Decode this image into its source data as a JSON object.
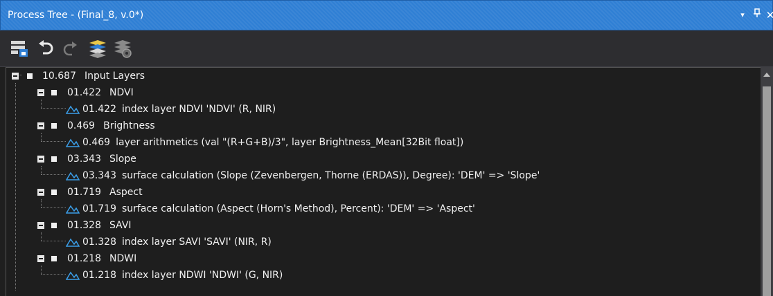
{
  "window": {
    "title": "Process Tree - (Final_8, v.0*)",
    "dropdown_glyph": "▾",
    "pin_glyph": "``",
    "close_glyph": "✕"
  },
  "toolbar": {
    "icons": [
      "rule-set-icon",
      "undo-icon",
      "redo-icon",
      "layers-icon",
      "layers-settings-icon"
    ],
    "colors": {
      "undo": "#e8e8e8",
      "redo_disabled": "#7a7a7a",
      "accent": "#2f7fd4",
      "accent_yellow": "#e8c84a"
    }
  },
  "tree": {
    "root": {
      "time": "10.687",
      "name": "Input Layers"
    },
    "groups": [
      {
        "time": "01.422",
        "name": "NDVI",
        "child": {
          "time": "01.422",
          "algorithm": "index layer NDVI 'NDVI' (R, NIR)"
        }
      },
      {
        "time": "0.469",
        "name": "Brightness",
        "child": {
          "time": "0.469",
          "algorithm": "layer arithmetics (val \"(R+G+B)/3\", layer Brightness_Mean[32Bit float])"
        }
      },
      {
        "time": "03.343",
        "name": "Slope",
        "child": {
          "time": "03.343",
          "algorithm": "surface calculation (Slope (Zevenbergen, Thorne (ERDAS)), Degree): 'DEM' => 'Slope'"
        }
      },
      {
        "time": "01.719",
        "name": "Aspect",
        "child": {
          "time": "01.719",
          "algorithm": "surface calculation (Aspect (Horn's Method), Percent): 'DEM' => 'Aspect'"
        }
      },
      {
        "time": "01.328",
        "name": "SAVI",
        "child": {
          "time": "01.328",
          "algorithm": "index layer SAVI 'SAVI' (NIR, R)"
        }
      },
      {
        "time": "01.218",
        "name": "NDWI",
        "child": {
          "time": "01.218",
          "algorithm": "index layer NDWI 'NDWI' (G, NIR)"
        }
      }
    ]
  }
}
